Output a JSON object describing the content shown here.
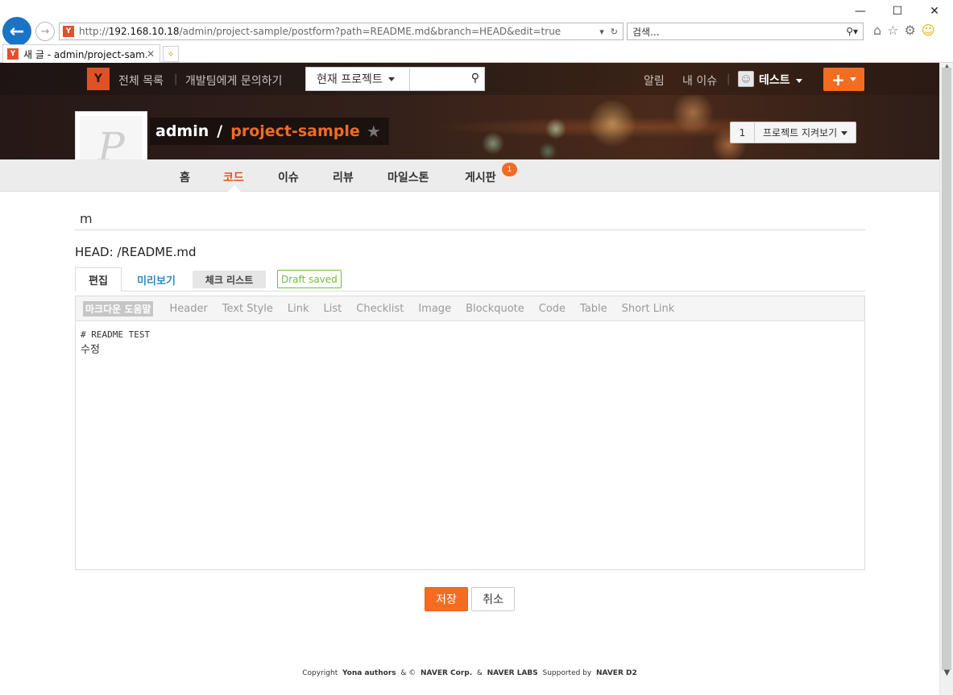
{
  "browser": {
    "url_prefix": "http://",
    "url_host": "192.168.10.18",
    "url_path": "/admin/project-sample/postform?path=README.md&branch=HEAD&edit=true",
    "search_placeholder": "검색...",
    "tab_title": "새 글 - admin/project-sam...",
    "favicon_letter": "Y"
  },
  "gnb": {
    "logo": "Y",
    "all_list": "전체 목록",
    "contact": "개발팀에게 문의하기",
    "project_select": "현재 프로젝트",
    "notifications": "알림",
    "my_issues": "내 이슈",
    "user": "테스트"
  },
  "project": {
    "logo_letter": "P",
    "owner": "admin",
    "separator": "/",
    "name": "project-sample",
    "watch_count": "1",
    "watch_label": "프로젝트 지켜보기"
  },
  "nav": {
    "home": "홈",
    "code": "코드",
    "issues": "이슈",
    "review": "리뷰",
    "milestones": "마일스톤",
    "board": "게시판",
    "board_badge": "1"
  },
  "form": {
    "title_value": "m",
    "path": "HEAD: /README.md",
    "tab_edit": "편집",
    "tab_preview": "미리보기",
    "tab_checklist": "체크 리스트",
    "draft_status": "Draft saved",
    "markdown_help": "마크다운 도움말",
    "toolbar": [
      "Header",
      "Text Style",
      "Link",
      "List",
      "Checklist",
      "Image",
      "Blockquote",
      "Code",
      "Table",
      "Short Link"
    ],
    "content_line1": "# README TEST",
    "content_line2": "수정",
    "save": "저장",
    "cancel": "취소"
  },
  "footer": {
    "copyright": "Copyright",
    "yona": "Yona authors",
    "amp1": "& ©",
    "naver_corp": "NAVER Corp.",
    "amp2": "&",
    "naver_labs": "NAVER LABS",
    "supported": "Supported by",
    "naver_d2": "NAVER D2"
  },
  "colors": {
    "accent": "#f36c21",
    "link": "#2e8cbb",
    "draft": "#6fbd3a"
  }
}
